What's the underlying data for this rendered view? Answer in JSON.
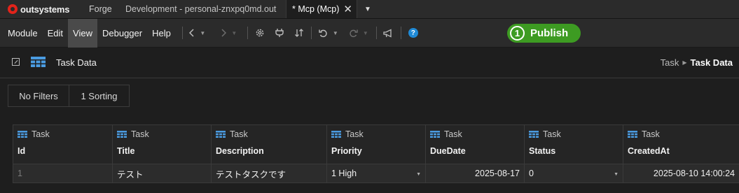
{
  "app": {
    "logo_text": "outsystems"
  },
  "tabs": {
    "forge": "Forge",
    "development": "Development - personal-znxpq0md.out",
    "active": "* Mcp (Mcp)",
    "close_glyph": "✕",
    "dropdown_glyph": "▼"
  },
  "menu": {
    "items": [
      "Module",
      "Edit",
      "View",
      "Debugger",
      "Help"
    ],
    "active_item": "View"
  },
  "toolbar": {
    "icons": [
      "back-arrow-icon",
      "forward-arrow-icon",
      "settings-icon",
      "plug-icon",
      "compare-icon",
      "undo-icon",
      "redo-icon",
      "announce-icon",
      "help-icon"
    ],
    "help_glyph": "?"
  },
  "publish": {
    "count": "1",
    "label": "Publish",
    "color": "#3d9b22"
  },
  "page": {
    "title": "Task Data",
    "breadcrumb": [
      "Task",
      "Task Data"
    ]
  },
  "filters": {
    "no_filters": "No Filters",
    "sorting": "1 Sorting"
  },
  "grid": {
    "entity": "Task",
    "columns": [
      "Id",
      "Title",
      "Description",
      "Priority",
      "DueDate",
      "Status",
      "CreatedAt"
    ],
    "rows": [
      {
        "id": "1",
        "title": "テスト",
        "description": "テストタスクです",
        "priority": "1 High",
        "due_date": "2025-08-17",
        "status": "0",
        "created_at": "2025-08-10 14:00:24"
      }
    ]
  },
  "colors": {
    "accent_blue": "#1f8ad6",
    "entity_icon": "#4a9be0"
  }
}
